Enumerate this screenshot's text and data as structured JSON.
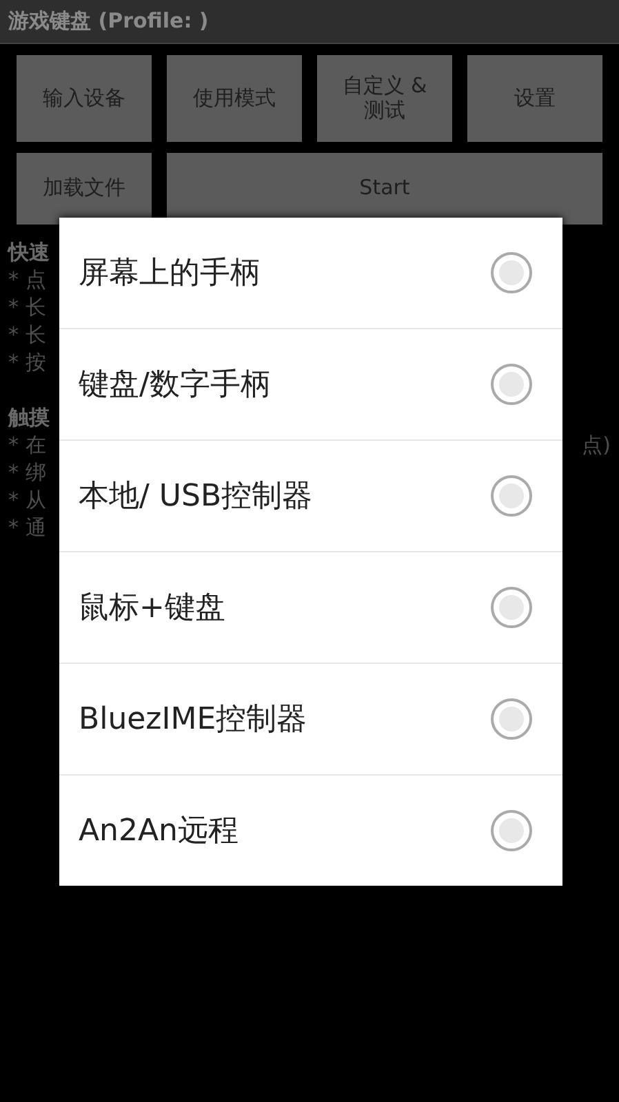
{
  "title": "游戏键盘 (Profile: )",
  "buttons": [
    {
      "label": "输入设备"
    },
    {
      "label": "使用模式"
    },
    {
      "label": "自定义 &\n测试"
    },
    {
      "label": "设置"
    }
  ],
  "buttons_row2": [
    {
      "label": "加载文件",
      "wide": false
    },
    {
      "label": "Start",
      "wide": true
    }
  ],
  "help": [
    {
      "kind": "heading",
      "text": "快速"
    },
    {
      "kind": "bullet",
      "text": "* 点"
    },
    {
      "kind": "bullet",
      "text": "* 长"
    },
    {
      "kind": "bullet",
      "text": "* 长"
    },
    {
      "kind": "bullet",
      "text": "* 按"
    },
    {
      "kind": "gap"
    },
    {
      "kind": "heading",
      "text": "触摸"
    },
    {
      "kind": "bullet",
      "text": "* 在",
      "tail": "点)"
    },
    {
      "kind": "bullet",
      "text": "* 绑"
    },
    {
      "kind": "bullet",
      "text": "* 从"
    },
    {
      "kind": "bullet",
      "text": "* 通"
    }
  ],
  "dialog": {
    "options": [
      {
        "label": "屏幕上的手柄",
        "selected": false
      },
      {
        "label": "键盘/数字手柄",
        "selected": false
      },
      {
        "label": "本地/ USB控制器",
        "selected": false
      },
      {
        "label": "鼠标+键盘",
        "selected": false
      },
      {
        "label": "BluezIME控制器",
        "selected": false
      },
      {
        "label": "An2An远程",
        "selected": false
      }
    ]
  }
}
